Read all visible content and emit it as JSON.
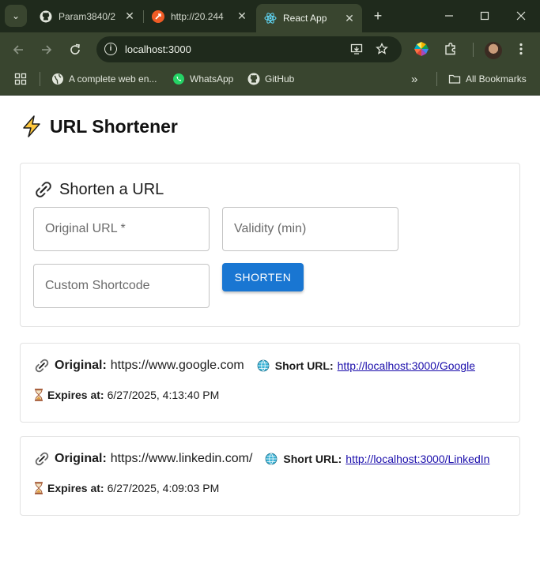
{
  "browser": {
    "tabs": [
      {
        "title": "Param3840/2",
        "favicon": "github-icon",
        "active": false
      },
      {
        "title": "http://20.244",
        "favicon": "postman-icon",
        "active": false
      },
      {
        "title": "React App",
        "favicon": "react-icon",
        "active": true
      }
    ],
    "url": "localhost:3000",
    "bookmarks": [
      {
        "label": "A complete web en..."
      },
      {
        "label": "WhatsApp"
      },
      {
        "label": "GitHub"
      }
    ],
    "all_bookmarks_label": "All Bookmarks",
    "colors": {
      "frame": "#1f2a1c",
      "toolbar": "#39452f",
      "omnibox": "#1f2a1c"
    }
  },
  "app": {
    "title": "URL Shortener",
    "form": {
      "heading": "Shorten a URL",
      "original_url_placeholder": "Original URL *",
      "validity_placeholder": "Validity (min)",
      "shortcode_placeholder": "Custom Shortcode",
      "submit_label": "SHORTEN"
    },
    "results": [
      {
        "original_label": "Original:",
        "original_url": "https://www.google.com",
        "short_label": "Short URL:",
        "short_url": "http://localhost:3000/Google",
        "expires_label": "Expires at:",
        "expires_at": "6/27/2025, 4:13:40 PM"
      },
      {
        "original_label": "Original:",
        "original_url": "https://www.linkedin.com/",
        "short_label": "Short URL:",
        "short_url": "http://localhost:3000/LinkedIn",
        "expires_label": "Expires at:",
        "expires_at": "6/27/2025, 4:09:03 PM"
      }
    ],
    "colors": {
      "primary": "#1976d2",
      "link": "#1a0dab",
      "card_border": "#e2e2e2"
    }
  }
}
